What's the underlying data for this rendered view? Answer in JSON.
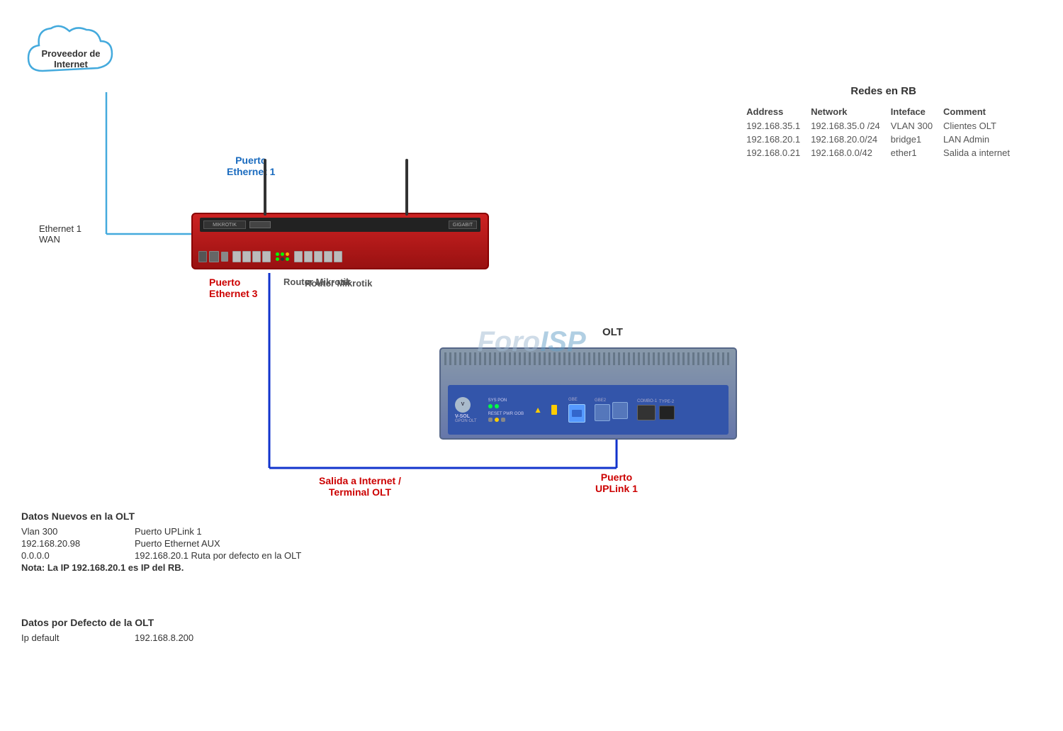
{
  "cloud": {
    "label_line1": "Proveedor de",
    "label_line2": "Internet"
  },
  "connections": {
    "ethernet1_wan_label": "Ethernet 1\nWAN",
    "puerto_eth1_label": "Puerto\nEthernet 1",
    "puerto_eth3_label": "Puerto\nEthernet 3",
    "router_label": "Router Mikrotik",
    "olt_label": "OLT",
    "salida_label": "Salida a Internet /\nTerminal  OLT",
    "puerto_uplink_label": "Puerto\nUPLink 1"
  },
  "redes_rb": {
    "title": "Redes en RB",
    "headers": [
      "Address",
      "Network",
      "Inteface",
      "Comment"
    ],
    "rows": [
      [
        "192.168.35.1",
        "192.168.35.0 /24",
        "VLAN 300",
        "Clientes OLT"
      ],
      [
        "192.168.20.1",
        "192.168.20.0/24",
        "bridge1",
        "LAN Admin"
      ],
      [
        "192.168.0.21",
        "192.168.0.0/42",
        "ether1",
        "Salida a internet"
      ]
    ]
  },
  "datos_nuevos": {
    "title": "Datos Nuevos en  la OLT",
    "rows": [
      {
        "key": "Vlan 300",
        "val": "Puerto UPLink 1"
      },
      {
        "key": "192.168.20.98",
        "val": "Puerto Ethernet AUX"
      },
      {
        "key": "0.0.0.0",
        "val": "192.168.20.1    Ruta  por defecto en la OLT"
      }
    ],
    "nota": "Nota: La IP 192.168.20.1 es IP del RB."
  },
  "datos_defecto": {
    "title": "Datos por Defecto de la OLT",
    "rows": [
      {
        "key": "Ip default",
        "val": "192.168.8.200"
      }
    ]
  },
  "watermark": "ForoISP",
  "olt_logo_line1": "V-SOL",
  "olt_logo_line2": "GPON OLT"
}
